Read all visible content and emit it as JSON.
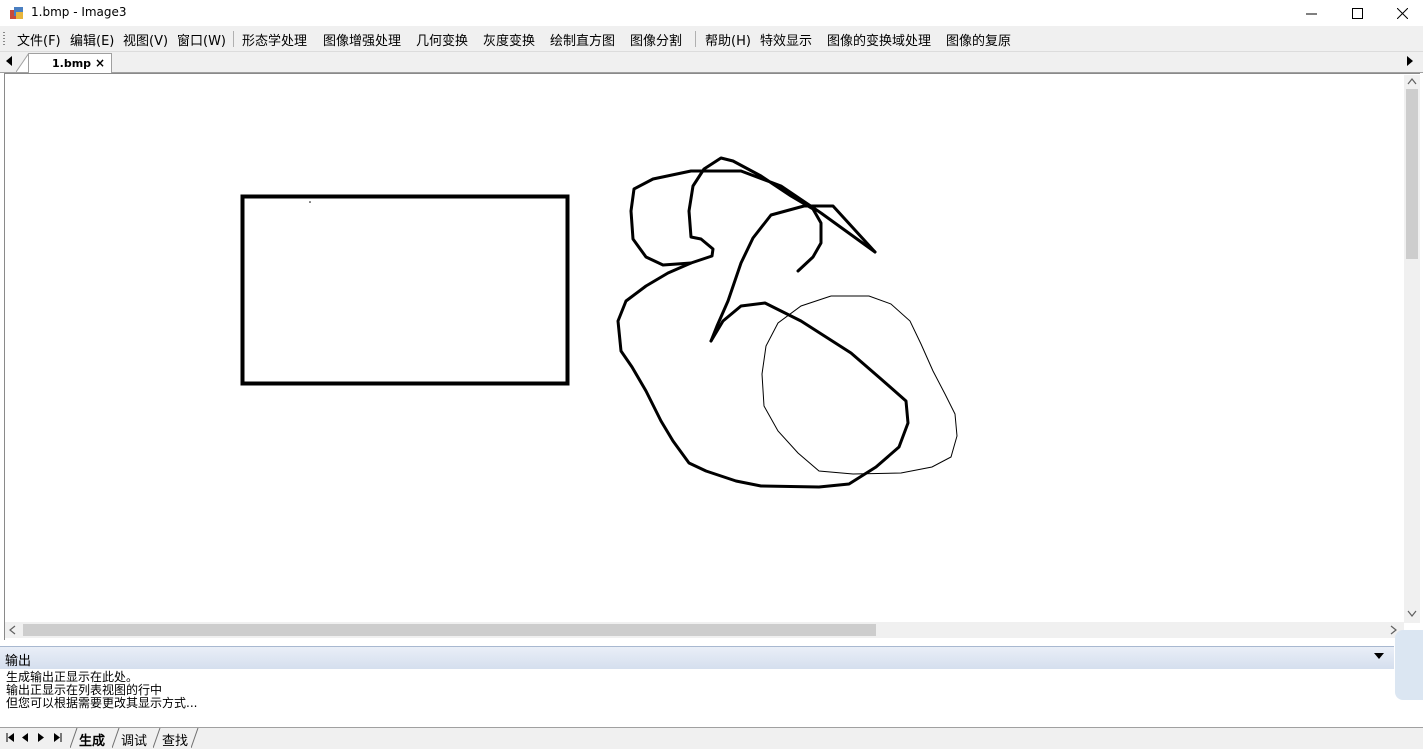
{
  "window": {
    "title": "1.bmp - Image3",
    "app_icon": "app-icon",
    "controls": [
      "minimize-icon",
      "maximize-icon",
      "close-icon"
    ]
  },
  "menu": {
    "items": [
      "文件(F)",
      "编辑(E)",
      "视图(V)",
      "窗口(W)",
      "形态学处理",
      "图像增强处理",
      "几何变换",
      "灰度变换",
      "绘制直方图",
      "图像分割",
      "帮助(H)",
      "特效显示",
      "图像的变换域处理",
      "图像的复原"
    ]
  },
  "document_tab": {
    "label": "1.bmp",
    "close": "×"
  },
  "output": {
    "title": "输出",
    "lines": [
      "生成输出正显示在此处。",
      "输出正显示在列表视图的行中",
      "但您可以根据需要更改其显示方式..."
    ]
  },
  "bottom_tabs": [
    "生成",
    "调试",
    "查找"
  ],
  "colors": {
    "menu_bg": "#f0f0f0",
    "canvas_bg": "#ffffff",
    "stroke": "#000000",
    "output_header": "#d5dfee"
  }
}
